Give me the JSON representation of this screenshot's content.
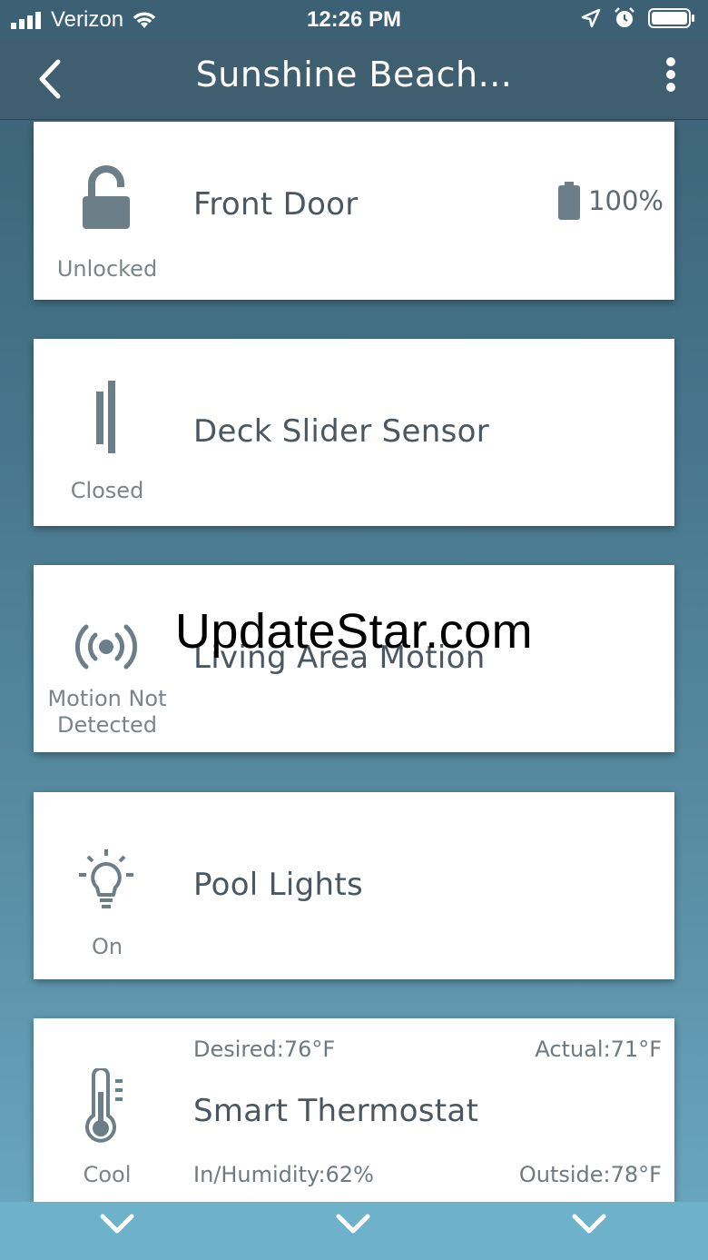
{
  "status_bar": {
    "carrier": "Verizon",
    "time": "12:26 PM"
  },
  "nav": {
    "title": "Sunshine Beach..."
  },
  "devices": [
    {
      "name": "Front Door",
      "state": "Unlocked",
      "icon": "lock-open-icon",
      "battery": "100%"
    },
    {
      "name": "Deck Slider Sensor",
      "state": "Closed",
      "icon": "contact-sensor-icon"
    },
    {
      "name": "Living Area Motion",
      "state_line1": "Motion Not",
      "state_line2": "Detected",
      "icon": "motion-sensor-icon"
    },
    {
      "name": "Pool Lights",
      "state": "On",
      "icon": "lightbulb-icon"
    },
    {
      "name": "Smart Thermostat",
      "state": "Cool",
      "icon": "thermometer-icon",
      "desired": "Desired:76°F",
      "actual": "Actual:71°F",
      "humidity": "In/Humidity:62%",
      "outside": "Outside:78°F"
    }
  ],
  "watermark": "UpdateStar.com",
  "colors": {
    "nav_bg": "#3f5e6f",
    "icon": "#6c7f89",
    "text": "#4a5760"
  }
}
